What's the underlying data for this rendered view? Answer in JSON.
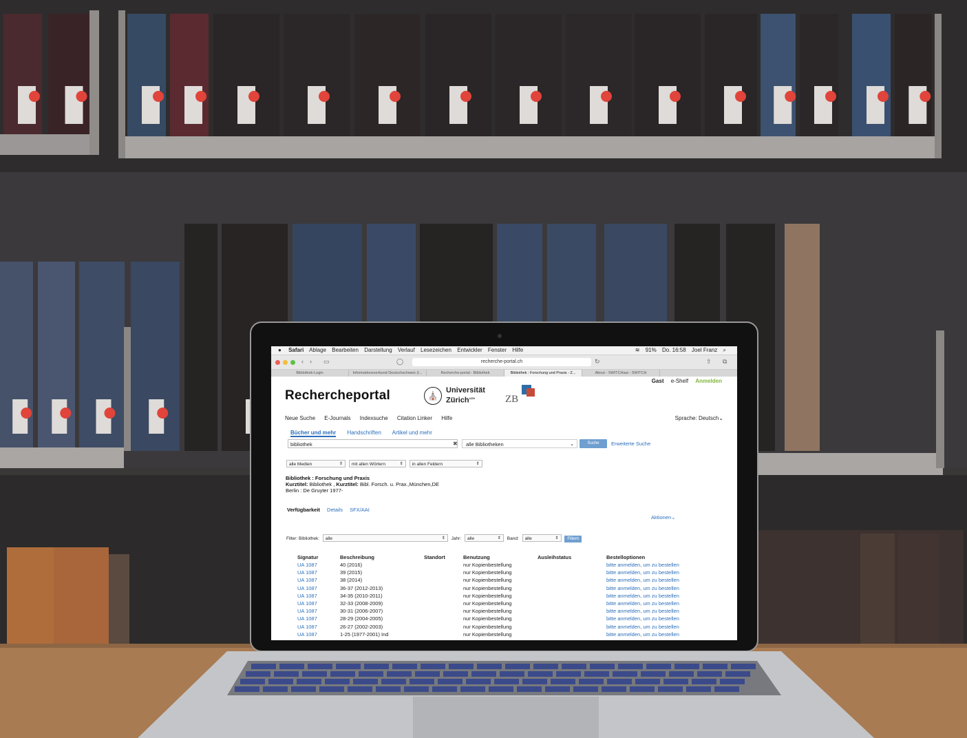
{
  "menubar": {
    "apple": "",
    "items": [
      "Safari",
      "Ablage",
      "Bearbeiten",
      "Darstellung",
      "Verlauf",
      "Lesezeichen",
      "Entwickler",
      "Fenster",
      "Hilfe"
    ],
    "status": "91%",
    "datetime": "Do. 16:58",
    "user": "Joel Franz"
  },
  "browser": {
    "url": "recherche-portal.ch",
    "tabs": [
      "Bibliothek-Login",
      "Informationsverbund Deutschschweiz (I...",
      "Recherche-portal - Bibliothek",
      "Bibliothek : Forschung und Praxis - Z...",
      "About - SWITCHaai - SWITCH"
    ],
    "active_tab_index": 3
  },
  "site": {
    "userbar": {
      "guest": "Gast",
      "shelf": "e-Shelf",
      "login": "Anmelden"
    },
    "title": "Rechercheportal",
    "uzh_line1": "Universität",
    "uzh_line2": "Zürich",
    "uzh_sup": "UZH",
    "zb": "ZB",
    "nav": [
      "Neue Suche",
      "E-Journals",
      "Indexsuche",
      "Citation Linker",
      "Hilfe"
    ],
    "language_label": "Sprache:",
    "language_value": "Deutsch"
  },
  "search": {
    "tabs": [
      "Bücher und mehr",
      "Handschriften",
      "Artikel und mehr"
    ],
    "active_tab": 0,
    "query": "bibliothek",
    "scope": "alle Bibliotheken",
    "button": "Suche",
    "advanced": "Erweiterte Suche",
    "filters": [
      "alle Medien",
      "mit allen Wörtern",
      "in allen Feldern"
    ]
  },
  "record": {
    "title": "Bibliothek : Forschung und Praxis",
    "short_label1": "Kurztitel:",
    "short_value1": "Bibliothek ,",
    "short_label2": "Kurztitel:",
    "short_value2": "Bibl. Forsch. u. Prax.,München,DE",
    "imprint": "Berlin : De Gruyter 1977-"
  },
  "availability": {
    "tabs": [
      "Verfügbarkeit",
      "Details",
      "SFX/AAI"
    ],
    "actions": "Aktionen",
    "filter_label": "Filter: Bibliothek:",
    "library_value": "alle",
    "year_label": "Jahr:",
    "year_value": "alle",
    "volume_label": "Band:",
    "volume_value": "alle",
    "filter_button": "Filtern"
  },
  "holdings": {
    "headers": [
      "Signatur",
      "Beschreibung",
      "Standort",
      "Benutzung",
      "Ausleihstatus",
      "Bestelloptionen"
    ],
    "rows": [
      [
        "UA 1087",
        "40 (2016)",
        "",
        "nur Kopienbestellung",
        "",
        "bitte anmelden, um zu bestellen"
      ],
      [
        "UA 1087",
        "39 (2015)",
        "",
        "nur Kopienbestellung",
        "",
        "bitte anmelden, um zu bestellen"
      ],
      [
        "UA 1087",
        "38 (2014)",
        "",
        "nur Kopienbestellung",
        "",
        "bitte anmelden, um zu bestellen"
      ],
      [
        "UA 1087",
        "36-37 (2012-2013)",
        "",
        "nur Kopienbestellung",
        "",
        "bitte anmelden, um zu bestellen"
      ],
      [
        "UA 1087",
        "34-35 (2010-2011)",
        "",
        "nur Kopienbestellung",
        "",
        "bitte anmelden, um zu bestellen"
      ],
      [
        "UA 1087",
        "32-33 (2008-2009)",
        "",
        "nur Kopienbestellung",
        "",
        "bitte anmelden, um zu bestellen"
      ],
      [
        "UA 1087",
        "30-31 (2006-2007)",
        "",
        "nur Kopienbestellung",
        "",
        "bitte anmelden, um zu bestellen"
      ],
      [
        "UA 1087",
        "28-29 (2004-2005)",
        "",
        "nur Kopienbestellung",
        "",
        "bitte anmelden, um zu bestellen"
      ],
      [
        "UA 1087",
        "26-27 (2002-2003)",
        "",
        "nur Kopienbestellung",
        "",
        "bitte anmelden, um zu bestellen"
      ],
      [
        "UA 1087",
        "1-25 (1977-2001) Ind",
        "",
        "nur Kopienbestellung",
        "",
        "bitte anmelden, um zu bestellen"
      ]
    ]
  },
  "colors": {
    "link": "#2a6ebb",
    "login": "#7fb539",
    "button": "#6f9fd0"
  }
}
